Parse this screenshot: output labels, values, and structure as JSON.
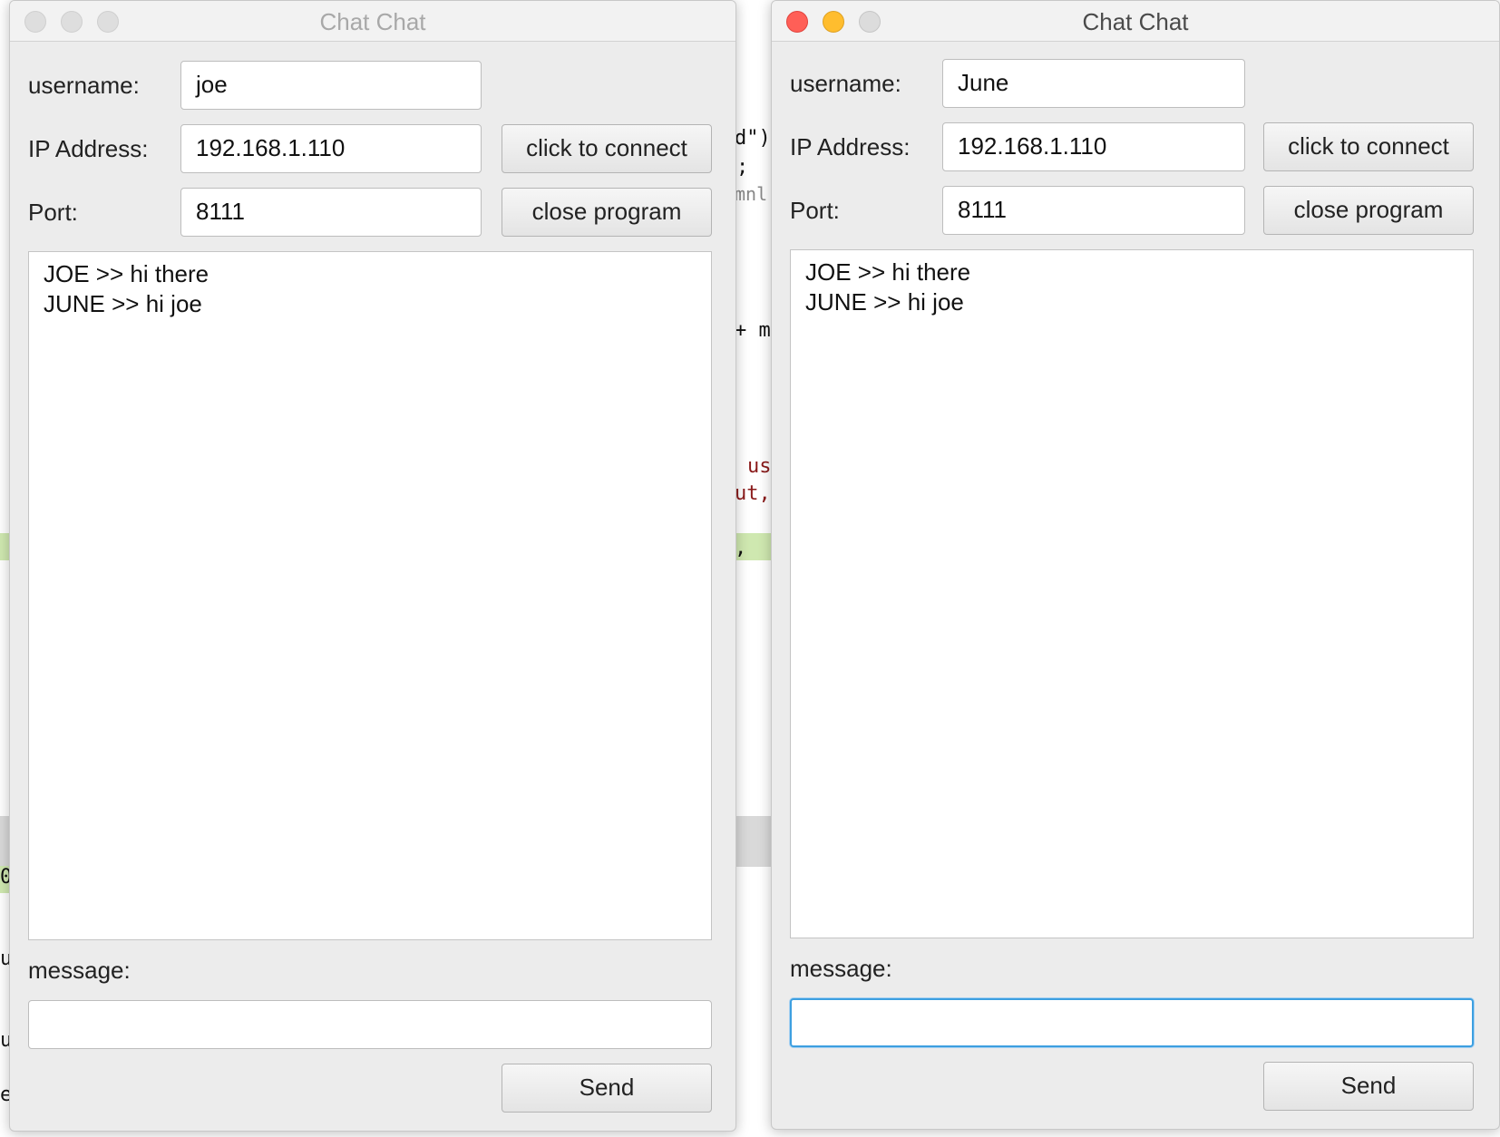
{
  "background_code": {
    "fragments": [
      "d\")",
      ";",
      "mnl",
      "+ m",
      "us",
      "ut,",
      ",",
      "0",
      "u",
      "u",
      "e"
    ]
  },
  "windows": [
    {
      "title": "Chat Chat",
      "active": false,
      "username_label": "username:",
      "username_value": "joe",
      "ip_label": "IP Address:",
      "ip_value": "192.168.1.110",
      "port_label": "Port:",
      "port_value": "8111",
      "connect_label": "click to connect",
      "close_label": "close program",
      "messages": [
        "JOE >> hi there",
        "JUNE >> hi joe"
      ],
      "message_label": "message:",
      "message_value": "",
      "send_label": "Send"
    },
    {
      "title": "Chat Chat",
      "active": true,
      "username_label": "username:",
      "username_value": "June",
      "ip_label": "IP Address:",
      "ip_value": "192.168.1.110",
      "port_label": "Port:",
      "port_value": "8111",
      "connect_label": "click to connect",
      "close_label": "close program",
      "messages": [
        "JOE >> hi there",
        "JUNE >> hi joe"
      ],
      "message_label": "message:",
      "message_value": "",
      "send_label": "Send"
    }
  ]
}
